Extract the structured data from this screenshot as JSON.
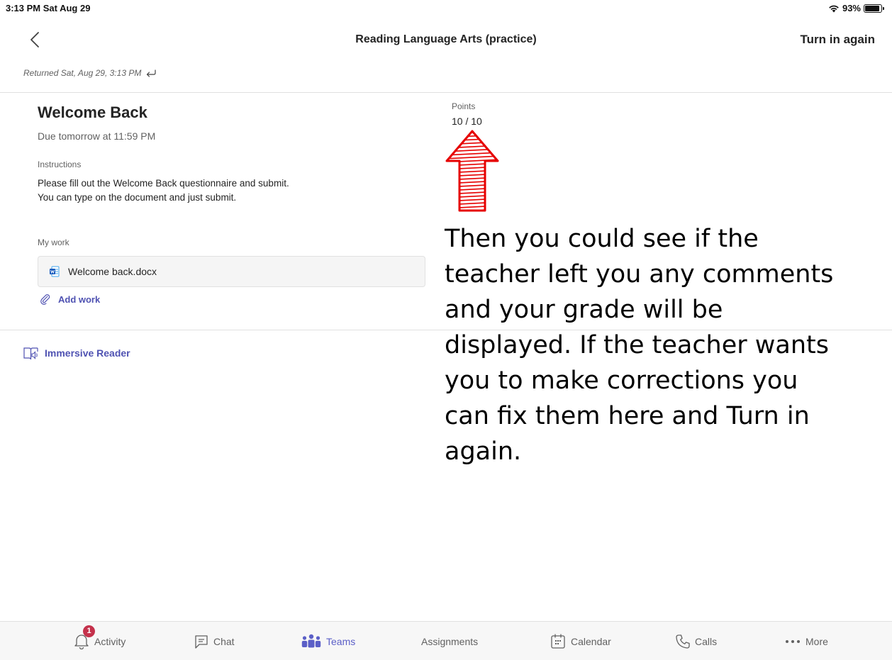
{
  "status_bar": {
    "time": "3:13 PM  Sat Aug 29",
    "battery": "93%",
    "battery_level": 0.93
  },
  "header": {
    "title": "Reading Language Arts (practice)",
    "turn_in_label": "Turn in again"
  },
  "returned_text": "Returned Sat, Aug 29, 3:13 PM",
  "assignment": {
    "title": "Welcome Back",
    "due": "Due tomorrow at 11:59 PM",
    "instructions_label": "Instructions",
    "instructions_lines": [
      "Please fill out the Welcome Back questionnaire and submit.",
      "You can type on the document and just submit."
    ],
    "my_work_label": "My work",
    "file_name": "Welcome back.docx",
    "add_work_label": "Add work"
  },
  "immersive_reader_label": "Immersive Reader",
  "points": {
    "label": "Points",
    "value": "10 / 10"
  },
  "annotation_lines": [
    "Then you could see if the",
    "teacher left you any comments",
    "and your grade will be",
    "displayed.  If the teacher wants",
    "you to make corrections you",
    "can fix them here and Turn in",
    "again."
  ],
  "bottom_nav": {
    "activity": {
      "label": "Activity",
      "badge": "1"
    },
    "chat": {
      "label": "Chat"
    },
    "teams": {
      "label": "Teams"
    },
    "assignments": {
      "label": "Assignments"
    },
    "calendar": {
      "label": "Calendar"
    },
    "calls": {
      "label": "Calls"
    },
    "more": {
      "label": "More"
    }
  },
  "colors": {
    "accent": "#5b5fc7",
    "link": "#4f52b2",
    "badge": "#c4314b",
    "arrow": "#e60000"
  }
}
